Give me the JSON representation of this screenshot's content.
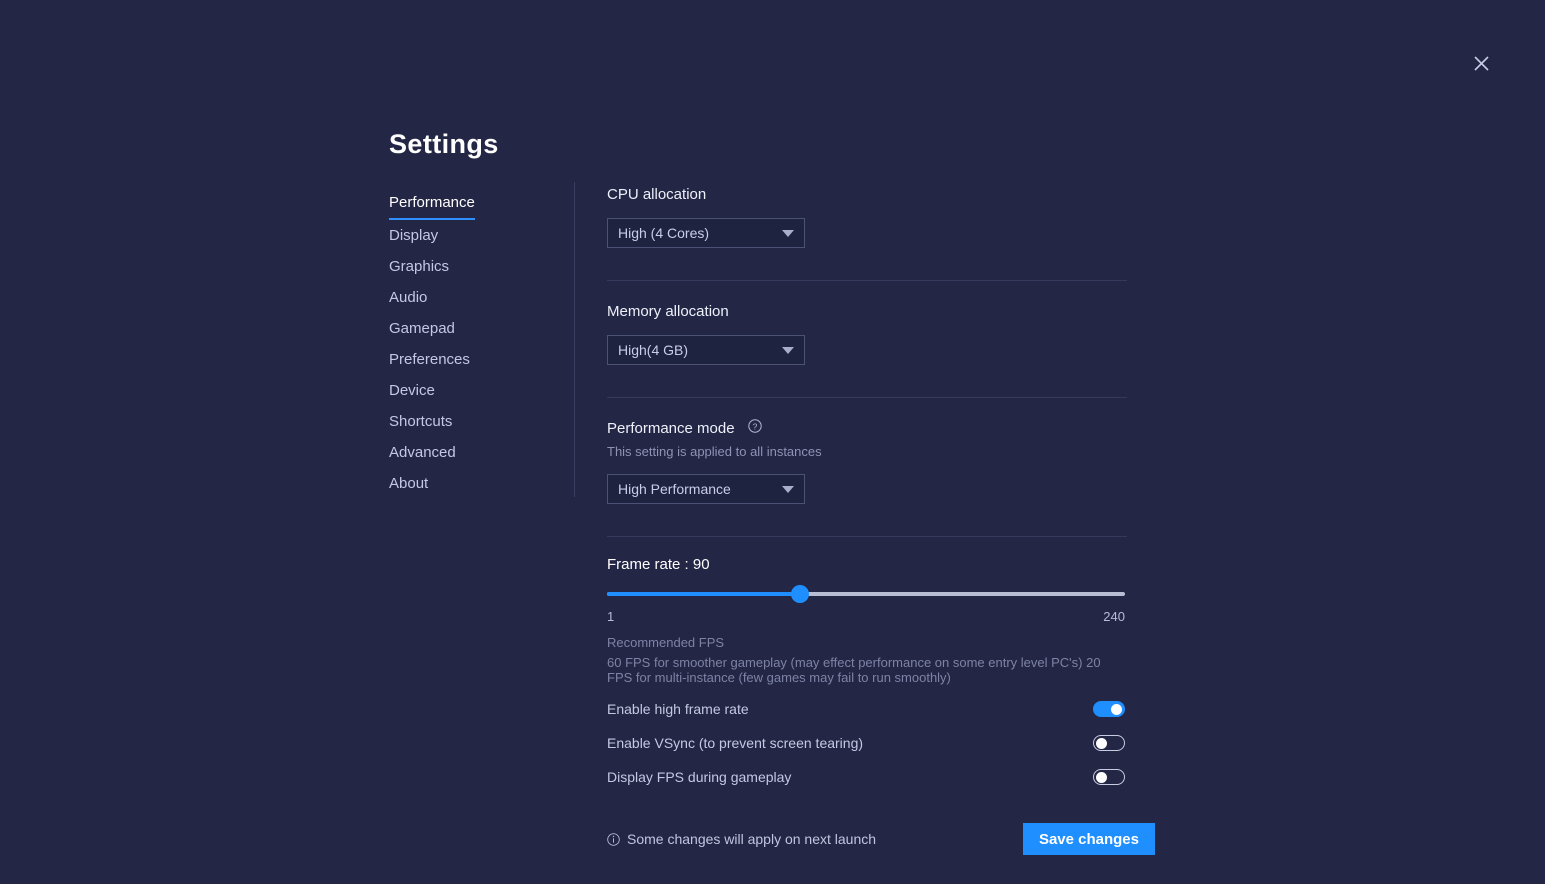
{
  "window": {
    "title": "Settings",
    "close_icon": "close-icon"
  },
  "colors": {
    "background": "#232745",
    "accent": "#1f8fff",
    "panel": "#1e2340",
    "divider": "#353a5c",
    "text_primary": "#eef0fa",
    "text_muted": "#8e93b5"
  },
  "sidebar": {
    "items": [
      {
        "label": "Performance",
        "active": true
      },
      {
        "label": "Display",
        "active": false
      },
      {
        "label": "Graphics",
        "active": false
      },
      {
        "label": "Audio",
        "active": false
      },
      {
        "label": "Gamepad",
        "active": false
      },
      {
        "label": "Preferences",
        "active": false
      },
      {
        "label": "Device",
        "active": false
      },
      {
        "label": "Shortcuts",
        "active": false
      },
      {
        "label": "Advanced",
        "active": false
      },
      {
        "label": "About",
        "active": false
      }
    ]
  },
  "main": {
    "cpu": {
      "label": "CPU allocation",
      "value": "High (4 Cores)"
    },
    "memory": {
      "label": "Memory allocation",
      "value": "High(4 GB)"
    },
    "performance_mode": {
      "label": "Performance mode",
      "help_icon": "help-circle-icon",
      "note": "This setting is applied to all instances",
      "value": "High Performance"
    },
    "frame_rate": {
      "label": "Frame rate : 90",
      "value": 90,
      "min": 1,
      "max": 240,
      "min_label": "1",
      "max_label": "240"
    },
    "recommended": {
      "title": "Recommended FPS",
      "body": "60 FPS for smoother gameplay (may effect performance on some entry level PC's) 20 FPS for multi-instance (few games may fail to run smoothly)"
    },
    "toggles": [
      {
        "label": "Enable high frame rate",
        "on": true
      },
      {
        "label": "Enable VSync (to prevent screen tearing)",
        "on": false
      },
      {
        "label": "Display FPS during gameplay",
        "on": false
      }
    ],
    "footer": {
      "info_icon": "info-circle-icon",
      "note": "Some changes will apply on next launch",
      "save_label": "Save changes"
    }
  }
}
